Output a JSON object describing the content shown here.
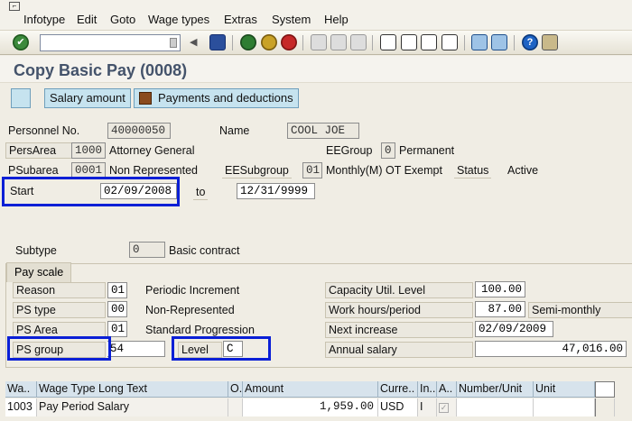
{
  "menubar": {
    "items": [
      "Infotype",
      "Edit",
      "Goto",
      "Wage types",
      "Extras",
      "System",
      "Help"
    ]
  },
  "toolbar": {
    "command_field_value": ""
  },
  "page": {
    "title": "Copy Basic Pay (0008)"
  },
  "app_toolbar": {
    "salary_amount_label": "Salary amount",
    "payments_label": "Payments and deductions"
  },
  "header": {
    "personnel_no_label": "Personnel No.",
    "personnel_no": "40000050",
    "name_label": "Name",
    "name": "COOL JOE",
    "persarea_label": "PersArea",
    "persarea_code": "1000",
    "persarea_text": "Attorney General",
    "eegroup_label": "EEGroup",
    "eegroup_code": "0",
    "eegroup_text": "Permanent",
    "psubarea_label": "PSubarea",
    "psubarea_code": "0001",
    "psubarea_text": "Non Represented",
    "eesubgroup_label": "EESubgroup",
    "eesubgroup_code": "01",
    "eesubgroup_text": "Monthly(M) OT Exempt",
    "status_label": "Status",
    "status_text": "Active",
    "start_label": "Start",
    "start_date": "02/09/2008",
    "to_label": "to",
    "end_date": "12/31/9999"
  },
  "subtype": {
    "label": "Subtype",
    "code": "0",
    "text": "Basic contract"
  },
  "pay_scale": {
    "title": "Pay scale",
    "reason_label": "Reason",
    "reason_code": "01",
    "reason_text": "Periodic Increment",
    "ps_type_label": "PS type",
    "ps_type_code": "00",
    "ps_type_text": "Non-Represented",
    "ps_area_label": "PS Area",
    "ps_area_code": "01",
    "ps_area_text": "Standard Progression",
    "ps_group_label": "PS group",
    "ps_group_value": "54",
    "level_label": "Level",
    "level_value": "C",
    "capacity_label": "Capacity Util. Level",
    "capacity_value": "100.00",
    "work_hours_label": "Work hours/period",
    "work_hours_value": "87.00",
    "work_hours_period": "Semi-monthly",
    "next_increase_label": "Next increase",
    "next_increase_value": "02/09/2009",
    "annual_salary_label": "Annual salary",
    "annual_salary_value": "47,016.00"
  },
  "wage_table": {
    "columns": [
      "Wa..",
      "Wage Type Long Text",
      "O..",
      "Amount",
      "Curre..",
      "In..",
      "A..",
      "Number/Unit",
      "Unit"
    ],
    "rows": [
      {
        "wage_type": "1003",
        "long_text": "Pay Period Salary",
        "o": "",
        "amount": "1,959.00",
        "currency": "USD",
        "ind": "I",
        "a": "",
        "number": "",
        "unit": ""
      }
    ]
  },
  "colors": {
    "highlight": "#0a1fd6",
    "title": "#44536b",
    "button_bg": "#c6e3ef"
  }
}
